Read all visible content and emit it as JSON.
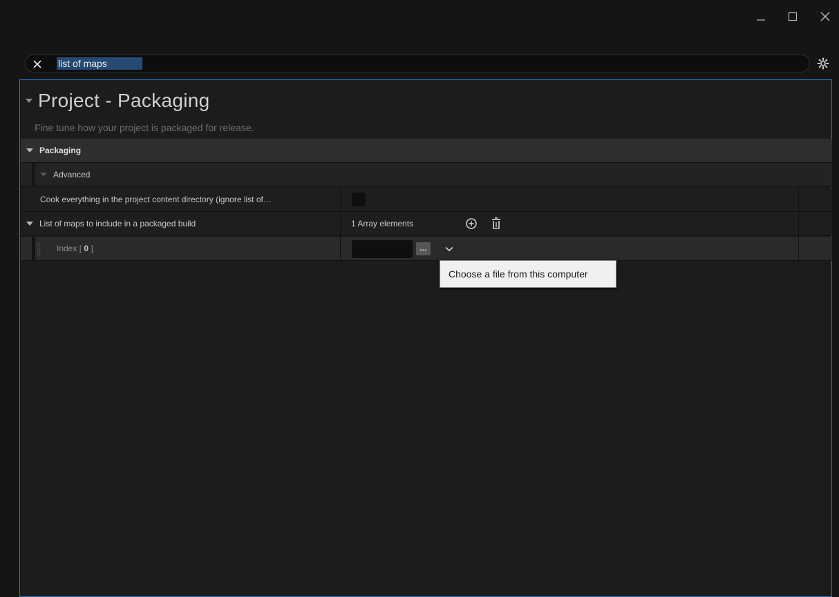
{
  "window": {
    "controls": [
      "minimize-icon",
      "maximize-icon",
      "close-icon"
    ]
  },
  "search": {
    "value": "list of maps",
    "clear_icon": "close-icon",
    "settings_icon": "gear-icon",
    "highlight_color": "#264a73"
  },
  "section": {
    "title": "Project - Packaging",
    "description": "Fine tune how your project is packaged for release."
  },
  "category": {
    "label": "Packaging"
  },
  "advanced": {
    "label": "Advanced"
  },
  "properties": {
    "cook_everything": {
      "label": "Cook everything in the project content directory (ignore list of…",
      "checked": false
    },
    "maps_list": {
      "label": "List of maps to include in a packaged build",
      "count_text": "1 Array elements",
      "add_icon": "plus-circle-icon",
      "clear_icon": "trash-icon"
    },
    "index_element": {
      "label_prefix": "Index [ ",
      "index": "0",
      "label_suffix": " ]",
      "browse_label": "...",
      "dropdown_icon": "chevron-down-icon"
    }
  },
  "tooltip": {
    "text": "Choose a file from this computer"
  },
  "colors": {
    "accent_border": "#2e6fc0",
    "background": "#1c1c1c"
  }
}
